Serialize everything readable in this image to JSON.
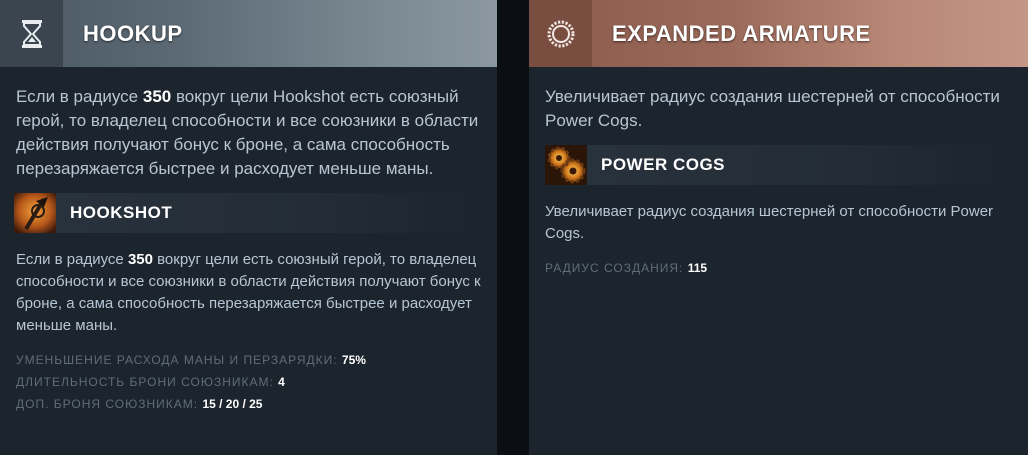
{
  "left": {
    "title": "HOOKUP",
    "header_icon": "hourglass-icon",
    "description": {
      "prefix": "Если в радиусе ",
      "value": "350",
      "suffix": " вокруг цели Hookshot есть союзный герой, то владелец способности и все союзники в области действия получают бонус к броне, а сама способность перезаряжается быстрее и расходует меньше маны."
    },
    "ability": {
      "name": "HOOKSHOT",
      "icon": "hookshot-icon",
      "description": {
        "prefix": "Если в радиусе ",
        "value": "350",
        "suffix": " вокруг цели есть союзный герой, то владелец способности и все союзники в области действия получают бонус к броне, а сама способность перезаряжается быстрее и расходует меньше маны."
      },
      "stats": [
        {
          "label": "УМЕНЬШЕНИЕ РАСХОДА МАНЫ И ПЕРЗАРЯДКИ:",
          "value": "75%"
        },
        {
          "label": "ДЛИТЕЛЬНОСТЬ БРОНИ СОЮЗНИКАМ:",
          "value": "4"
        },
        {
          "label": "ДОП. БРОНЯ СОЮЗНИКАМ:",
          "value": "15 / 20 / 25"
        }
      ]
    }
  },
  "right": {
    "title": "EXPANDED ARMATURE",
    "header_icon": "ring-icon",
    "description": "Увеличивает радиус создания шестерней от способности Power Cogs.",
    "ability": {
      "name": "POWER COGS",
      "icon": "power-cogs-icon",
      "description": "Увеличивает радиус создания шестерней от способности Power Cogs.",
      "stats": [
        {
          "label": "РАДИУС СОЗДАНИЯ:",
          "value": "115"
        }
      ]
    }
  }
}
